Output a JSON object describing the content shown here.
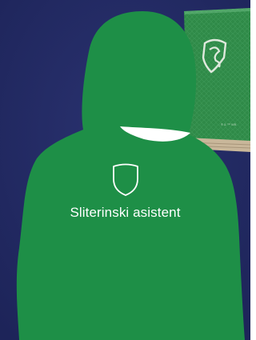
{
  "caption": "Sliterinski asistent",
  "colors": {
    "background": "#222a63",
    "silhouette": "#1e8f47",
    "book": "#2f8a48",
    "book_pages": "#c9b79a",
    "crest_outline": "#ffffff"
  },
  "icons": {
    "crest": "shield-icon"
  }
}
